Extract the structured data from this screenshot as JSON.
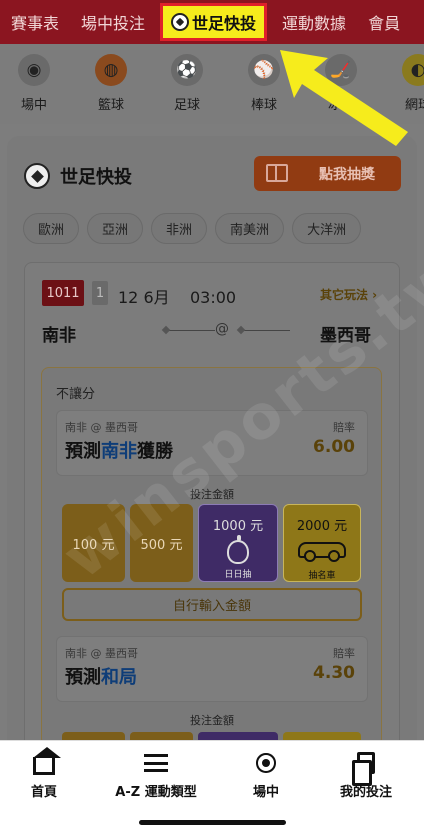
{
  "top_nav": {
    "tabs": [
      "賽事表",
      "場中投注",
      "世足快投",
      "運動數據",
      "會員"
    ],
    "active_index": 2,
    "highlight_color": "#f6ec1c",
    "highlight_border": "#e0202a"
  },
  "sports": [
    {
      "label": "場中",
      "icon": "live-broadcast-icon"
    },
    {
      "label": "籃球",
      "icon": "basketball-icon"
    },
    {
      "label": "足球",
      "icon": "soccer-ball-icon"
    },
    {
      "label": "棒球",
      "icon": "baseball-icon"
    },
    {
      "label": "冰球",
      "icon": "ice-hockey-icon"
    },
    {
      "label": "網球",
      "icon": "tennis-icon"
    }
  ],
  "section": {
    "title": "世足快投",
    "draw_button": "點我抽獎",
    "regions": [
      "歐洲",
      "亞洲",
      "非洲",
      "南美洲",
      "大洋洲"
    ]
  },
  "match": {
    "code": "1011",
    "badge": "1",
    "date": "12 6月",
    "time": "03:00",
    "other_plays": "其它玩法 ›",
    "home": "南非",
    "at": "@",
    "away": "墨西哥"
  },
  "bet": {
    "type": "不讓分",
    "options": [
      {
        "matchup": "南非 @ 墨西哥",
        "prefix": "預測",
        "team": "南非",
        "suffix": "獲勝",
        "odds_label": "賠率",
        "odds": "6.00"
      },
      {
        "matchup": "南非 @ 墨西哥",
        "prefix": "預測",
        "team": "和局",
        "suffix": "",
        "odds_label": "賠率",
        "odds": "4.30"
      }
    ],
    "amount_header": "投注金額",
    "amounts": [
      {
        "label": "100 元"
      },
      {
        "label": "500 元"
      },
      {
        "label": "1000 元",
        "sub": "日日抽",
        "icon": "apple-icon"
      },
      {
        "label": "2000 元",
        "sub": "抽名車",
        "icon": "car-icon"
      }
    ],
    "custom_amount": "自行輸入金額"
  },
  "watermark": "winsports.tw",
  "bottom_nav": [
    {
      "label": "首頁",
      "icon": "home-icon"
    },
    {
      "label": "A-Z 運動類型",
      "icon": "menu-icon"
    },
    {
      "label": "場中",
      "icon": "live-icon"
    },
    {
      "label": "我的投注",
      "icon": "documents-icon"
    }
  ]
}
